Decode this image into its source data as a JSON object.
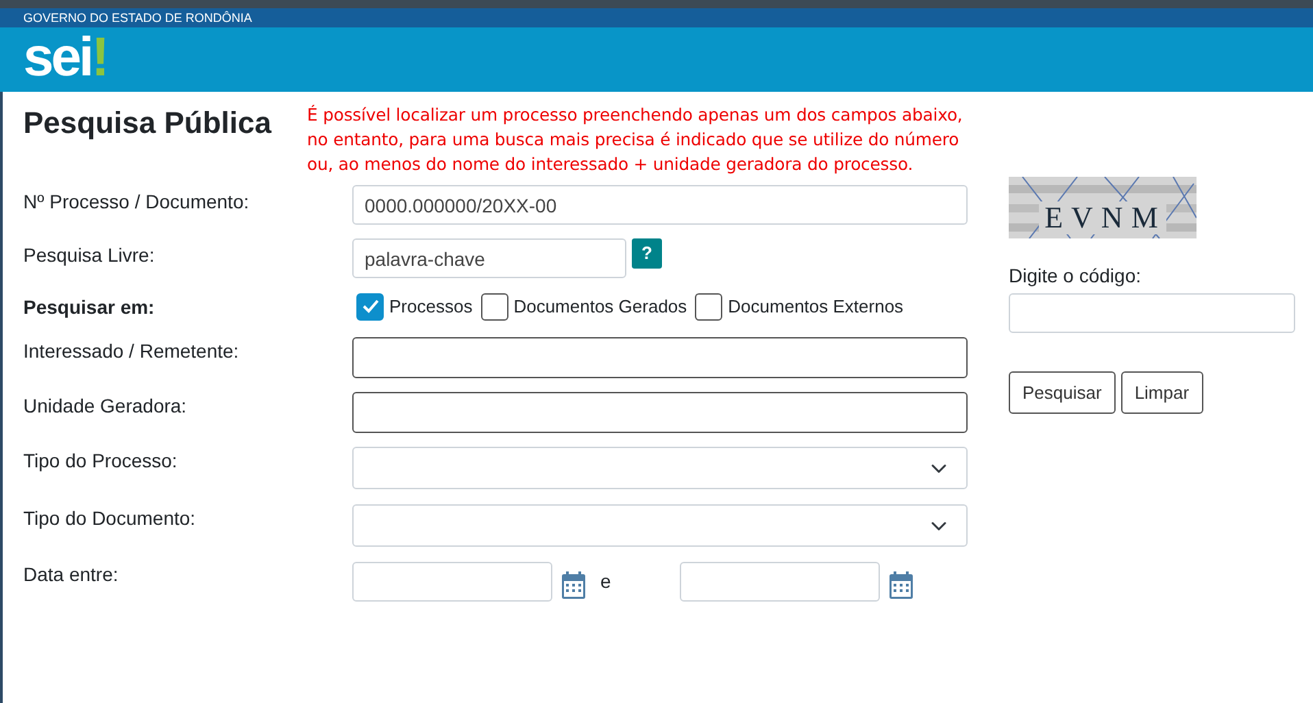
{
  "header": {
    "government": "GOVERNO DO ESTADO DE RONDÔNIA",
    "logo": {
      "text": "sei",
      "mark": "!"
    }
  },
  "title": "Pesquisa Pública",
  "notice": "É possível localizar um processo preenchendo apenas um dos campos abaixo, no entanto, para uma busca mais precisa é indicado que se utilize do número ou, ao menos do nome do interessado + unidade geradora do processo.",
  "fields": [
    {
      "kind": "text",
      "label": "Nº Processo / Documento:",
      "placeholder": "0000.000000/20XX-00",
      "wide": true
    },
    {
      "kind": "text",
      "label": "Pesquisa Livre:",
      "placeholder": "palavra-chave",
      "wide": false,
      "help": "?"
    },
    {
      "kind": "checks",
      "label": "Pesquisar em:",
      "options": [
        {
          "label": "Processos",
          "checked": true
        },
        {
          "label": "Documentos Gerados",
          "checked": false
        },
        {
          "label": "Documentos Externos",
          "checked": false
        }
      ]
    },
    {
      "kind": "text",
      "label": "Interessado / Remetente:",
      "wide": true,
      "strong": true
    },
    {
      "kind": "text",
      "label": "Unidade Geradora:",
      "wide": true,
      "strong": true
    },
    {
      "kind": "select",
      "label": "Tipo do Processo:"
    },
    {
      "kind": "select",
      "label": "Tipo do Documento:"
    },
    {
      "kind": "dates",
      "label": "Data entre:",
      "separator": "e"
    }
  ],
  "captcha": {
    "code": "EVNM",
    "label": "Digite o código:"
  },
  "buttons": [
    "Pesquisar",
    "Limpar"
  ]
}
